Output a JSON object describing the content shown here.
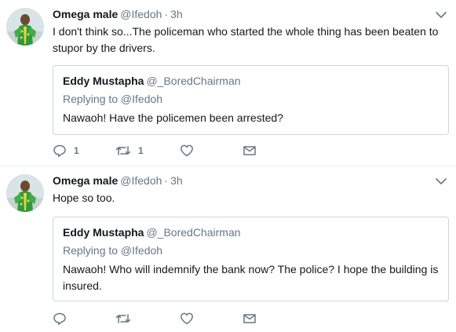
{
  "tweets": [
    {
      "author_name": "Omega male",
      "author_handle": "@Ifedoh",
      "separator": "·",
      "time": "3h",
      "text": "I don't think so...The policeman who started the whole thing has been beaten to stupor by the drivers.",
      "quote": {
        "author_name": "Eddy Mustapha",
        "author_handle": "@_BoredChairman",
        "replying_to": "Replying to @Ifedoh",
        "text": "Nawaoh! Have the policemen been arrested?"
      },
      "actions": {
        "reply_count": "1",
        "retweet_count": "1",
        "like_count": "",
        "dm_count": ""
      }
    },
    {
      "author_name": "Omega male",
      "author_handle": "@Ifedoh",
      "separator": "·",
      "time": "3h",
      "text": "Hope so too.",
      "quote": {
        "author_name": "Eddy Mustapha",
        "author_handle": "@_BoredChairman",
        "replying_to": "Replying to @Ifedoh",
        "text": "Nawaoh! Who will indemnify the bank now? The police? I hope the building is insured."
      },
      "actions": {
        "reply_count": "",
        "retweet_count": "",
        "like_count": "",
        "dm_count": ""
      }
    }
  ],
  "icons": {
    "reply": "reply-icon",
    "retweet": "retweet-icon",
    "like": "heart-icon",
    "dm": "envelope-icon",
    "more": "chevron-down-icon"
  },
  "colors": {
    "text": "#14171a",
    "secondary": "#657786",
    "border": "#e6ecf0",
    "quote_border": "#ccd6dd"
  }
}
